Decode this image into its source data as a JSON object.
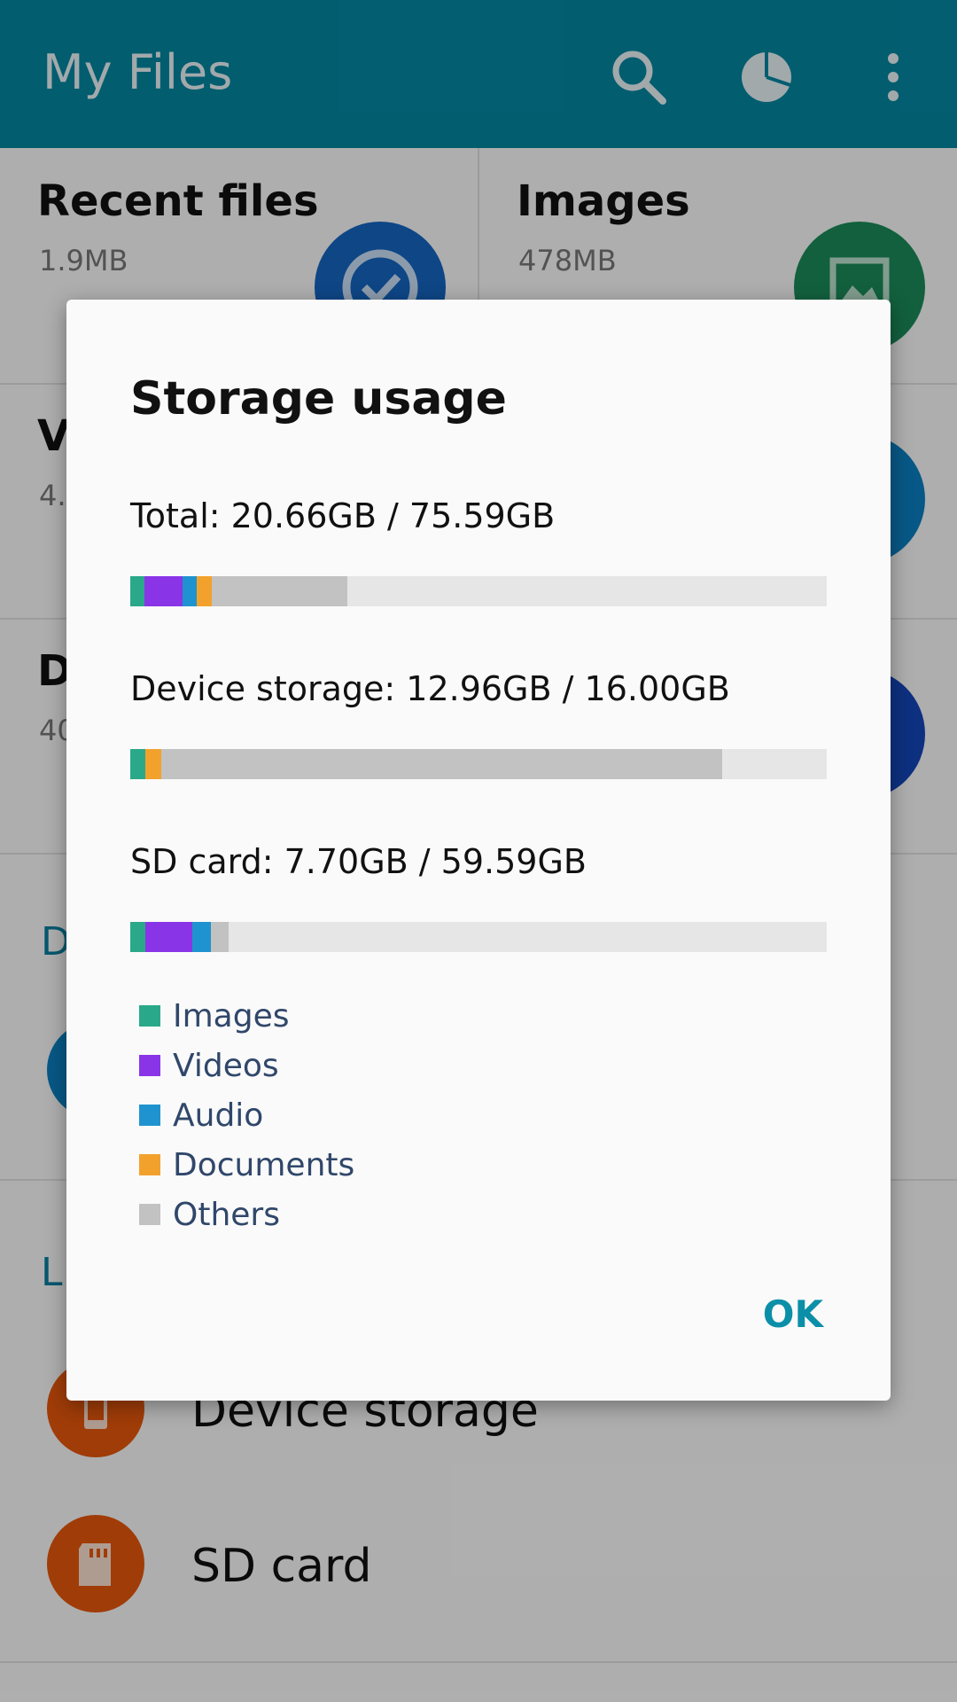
{
  "appbar": {
    "title": "My Files",
    "icons": [
      "search-icon",
      "storage-pie-icon",
      "more-vert-icon"
    ],
    "color": "#0386a0"
  },
  "categories": [
    {
      "title": "Recent files",
      "size": "1.9MB",
      "icon": "check-icon",
      "color": "#1565c0"
    },
    {
      "title": "Images",
      "size": "478MB",
      "icon": "image-icon",
      "color": "#1a8a5a"
    },
    {
      "title": "V",
      "size": "4.0",
      "icon": "video-icon",
      "color": "#0b7fc0"
    },
    {
      "title": "D",
      "size": "40",
      "icon": "document-icon",
      "color": "#1546b8"
    }
  ],
  "sections": {
    "first": "D",
    "second": "L"
  },
  "locations": [
    {
      "label": "Device storage",
      "icon": "phone-icon"
    },
    {
      "label": "SD card",
      "icon": "sd-card-icon"
    }
  ],
  "dialog": {
    "title": "Storage usage",
    "stats": [
      {
        "label": "Total: 20.66GB / 75.59GB",
        "segments": {
          "images": 0.02,
          "videos": 0.055,
          "audio": 0.02,
          "documents": 0.022,
          "others": 0.195
        }
      },
      {
        "label": "Device storage: 12.96GB / 16.00GB",
        "segments": {
          "images": 0.022,
          "videos": 0,
          "audio": 0,
          "documents": 0.023,
          "others": 0.805
        }
      },
      {
        "label": "SD card: 7.70GB / 59.59GB",
        "segments": {
          "images": 0.022,
          "videos": 0.067,
          "audio": 0.027,
          "documents": 0,
          "others": 0.025
        }
      }
    ],
    "legend": [
      {
        "key": "images",
        "label": "Images",
        "color": "#2aa88a"
      },
      {
        "key": "videos",
        "label": "Videos",
        "color": "#8a34e8"
      },
      {
        "key": "audio",
        "label": "Audio",
        "color": "#1f93cf"
      },
      {
        "key": "documents",
        "label": "Documents",
        "color": "#f2a22c"
      },
      {
        "key": "others",
        "label": "Others",
        "color": "#c2c2c2"
      }
    ],
    "ok_label": "OK"
  }
}
